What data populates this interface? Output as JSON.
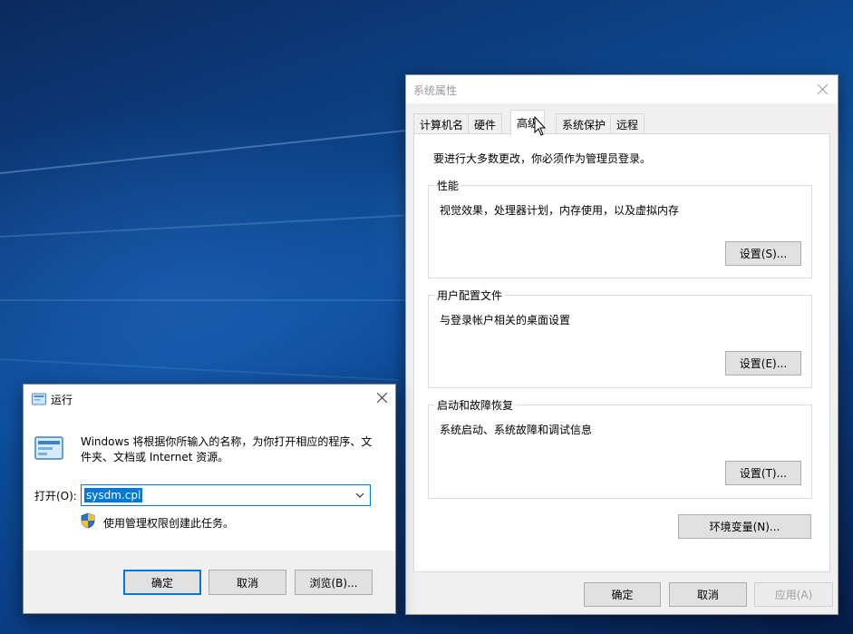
{
  "system_properties": {
    "title": "系统属性",
    "tabs": [
      {
        "label": "计算机名"
      },
      {
        "label": "硬件"
      },
      {
        "label": "高级"
      },
      {
        "label": "系统保护"
      },
      {
        "label": "远程"
      }
    ],
    "active_tab": "高级",
    "intro": "要进行大多数更改，你必须作为管理员登录。",
    "groups": {
      "performance": {
        "title": "性能",
        "desc": "视觉效果，处理器计划，内存使用，以及虚拟内存",
        "button": "设置(S)..."
      },
      "user_profiles": {
        "title": "用户配置文件",
        "desc": "与登录帐户相关的桌面设置",
        "button": "设置(E)..."
      },
      "startup_recovery": {
        "title": "启动和故障恢复",
        "desc": "系统启动、系统故障和调试信息",
        "button": "设置(T)..."
      }
    },
    "env_button": "环境变量(N)...",
    "ok": "确定",
    "cancel": "取消",
    "apply": "应用(A)"
  },
  "run_dialog": {
    "title": "运行",
    "description": "Windows 将根据你所输入的名称，为你打开相应的程序、文件夹、文档或 Internet 资源。",
    "open_label": "打开(O):",
    "input_value": "sysdm.cpl",
    "admin_note": "使用管理权限创建此任务。",
    "ok": "确定",
    "cancel": "取消",
    "browse": "浏览(B)..."
  },
  "colors": {
    "accent": "#0078d7",
    "window_bg": "#f0f0f0"
  }
}
